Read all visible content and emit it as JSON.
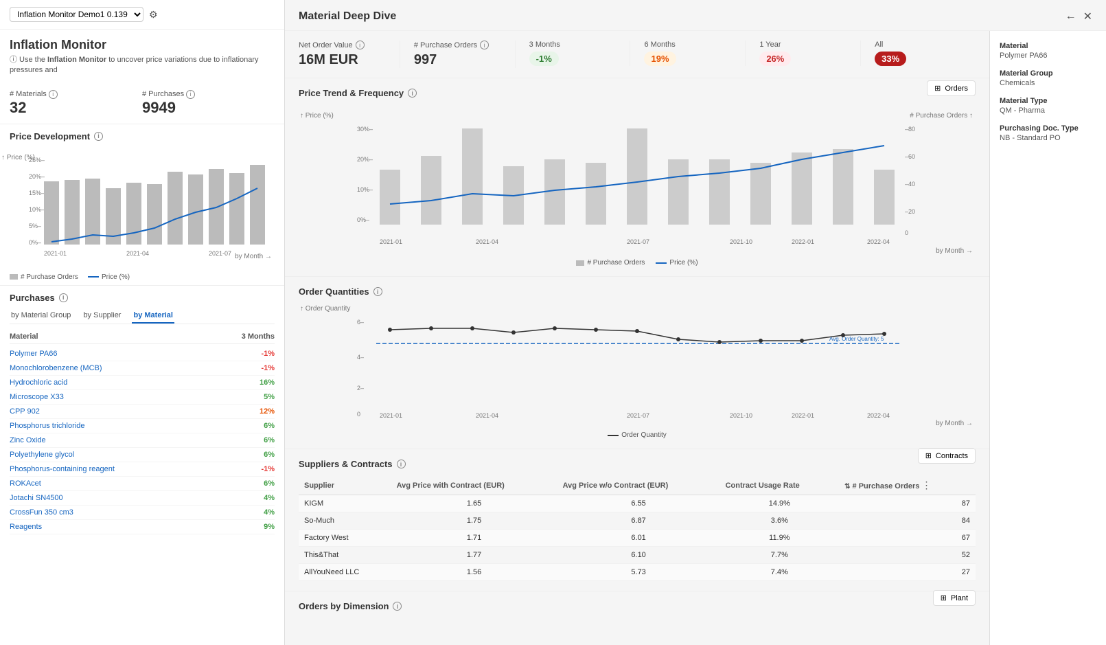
{
  "leftPanel": {
    "selectLabel": "Inflation Monitor Demo1",
    "selectVersion": "0.139",
    "title": "Inflation Monitor",
    "subtitle": "Use the Inflation Monitor to uncover price variations due to inflationary pressures and",
    "subtitleBold": "Inflation Monitor",
    "stats": {
      "materials": {
        "label": "# Materials",
        "value": "32"
      },
      "purchases": {
        "label": "# Purchases",
        "value": "9949"
      }
    },
    "priceDev": {
      "title": "Price Development",
      "yLabels": [
        "25%–",
        "20%–",
        "15%–",
        "10%–",
        "5%–",
        "0%"
      ],
      "xLabels": [
        "2021-01",
        "2021-04",
        "2021-07"
      ],
      "byMonth": "by Month →"
    },
    "legend": {
      "bar": "# Purchase Orders",
      "line": "Price (%)"
    },
    "purchases": {
      "title": "Purchases",
      "tabs": [
        "by Material Group",
        "by Supplier",
        "by Material"
      ],
      "activeTab": "by Material",
      "colMaterial": "Material",
      "col3Months": "3 Months",
      "rows": [
        {
          "name": "Polymer PA66",
          "pct": "-1%",
          "type": "negative"
        },
        {
          "name": "Monochlorobenzene (MCB)",
          "pct": "-1%",
          "type": "negative"
        },
        {
          "name": "Hydrochloric acid",
          "pct": "16%",
          "type": "positive-green"
        },
        {
          "name": "Microscope X33",
          "pct": "5%",
          "type": "positive-green"
        },
        {
          "name": "CPP 902",
          "pct": "12%",
          "type": "positive-orange"
        },
        {
          "name": "Phosphorus trichloride",
          "pct": "6%",
          "type": "positive-green"
        },
        {
          "name": "Zinc Oxide",
          "pct": "6%",
          "type": "positive-green"
        },
        {
          "name": "Polyethylene glycol",
          "pct": "6%",
          "type": "positive-green"
        },
        {
          "name": "Phosphorus-containing reagent",
          "pct": "-1%",
          "type": "negative"
        },
        {
          "name": "ROKAcet",
          "pct": "6%",
          "type": "positive-green"
        },
        {
          "name": "Jotachi SN4500",
          "pct": "4%",
          "type": "positive-green"
        },
        {
          "name": "CrossFun 350 cm3",
          "pct": "4%",
          "type": "positive-green"
        },
        {
          "name": "Reagents",
          "pct": "9%",
          "type": "positive-green"
        }
      ]
    }
  },
  "deepDive": {
    "title": "Material Deep Dive",
    "kpis": [
      {
        "label": "Net Order Value",
        "value": "16M EUR"
      },
      {
        "label": "# Purchase Orders",
        "value": "997"
      },
      {
        "label": "3 Months",
        "badge": "-1%",
        "badgeType": "green"
      },
      {
        "label": "6 Months",
        "badge": "19%",
        "badgeType": "orange"
      },
      {
        "label": "1 Year",
        "badge": "26%",
        "badgeType": "red"
      },
      {
        "label": "All",
        "badge": "33%",
        "badgeType": "dark-red"
      }
    ],
    "priceTrend": {
      "title": "Price Trend & Frequency",
      "tableBtn": "Orders",
      "yLabels": [
        "30%–",
        "20%–",
        "10%–",
        "0%–"
      ],
      "yLabelsRight": [
        "–80",
        "–60",
        "–40",
        "–20",
        "0"
      ],
      "xLabels": [
        "2021-01",
        "2021-04",
        "2021-07",
        "2021-10",
        "2022-01",
        "2022-04"
      ],
      "byMonth": "by Month →",
      "legendBar": "# Purchase Orders",
      "legendLine": "Price (%)"
    },
    "orderQuantities": {
      "title": "Order Quantities",
      "yLabels": [
        "6–",
        "4–",
        "2–",
        "0"
      ],
      "xLabels": [
        "2021-01",
        "2021-04",
        "2021-07",
        "2021-10",
        "2022-01",
        "2022-04"
      ],
      "byMonth": "by Month →",
      "avgLabel": "Avg. Order Quantity: 5",
      "legendLine": "Order Quantity"
    },
    "suppliers": {
      "title": "Suppliers & Contracts",
      "tableBtn": "Contracts",
      "columns": [
        "Supplier",
        "Avg Price with Contract (EUR)",
        "Avg Price w/o Contract (EUR)",
        "Contract Usage Rate",
        "# Purchase Orders"
      ],
      "rows": [
        {
          "supplier": "KIGM",
          "avgWith": "1.65",
          "avgWithout": "6.55",
          "usageRate": "14.9%",
          "orders": "87"
        },
        {
          "supplier": "So-Much",
          "avgWith": "1.75",
          "avgWithout": "6.87",
          "usageRate": "3.6%",
          "orders": "84"
        },
        {
          "supplier": "Factory West",
          "avgWith": "1.71",
          "avgWithout": "6.01",
          "usageRate": "11.9%",
          "orders": "67"
        },
        {
          "supplier": "This&That",
          "avgWith": "1.77",
          "avgWithout": "6.10",
          "usageRate": "7.7%",
          "orders": "52"
        },
        {
          "supplier": "AllYouNeed LLC",
          "avgWith": "1.56",
          "avgWithout": "5.73",
          "usageRate": "7.4%",
          "orders": "27"
        }
      ]
    },
    "ordersByDimension": {
      "title": "Orders by Dimension",
      "tableBtn": "Plant"
    }
  },
  "rightSidebar": {
    "items": [
      {
        "label": "Material",
        "value": "Polymer PA66"
      },
      {
        "label": "Material Group",
        "value": "Chemicals"
      },
      {
        "label": "Material Type",
        "value": "QM - Pharma"
      },
      {
        "label": "Purchasing Doc. Type",
        "value": "NB - Standard PO"
      }
    ]
  }
}
